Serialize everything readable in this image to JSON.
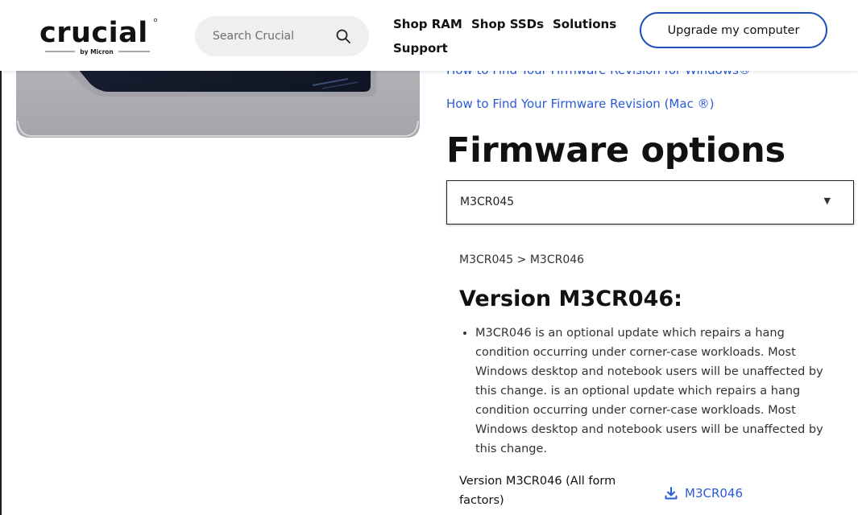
{
  "header": {
    "logo_text": "crucial",
    "logo_subtext": "by Micron",
    "search_placeholder": "Search Crucial",
    "nav": {
      "shop_ram": "Shop RAM",
      "shop_ssds": "Shop SSDs",
      "solutions": "Solutions",
      "support": "Support"
    },
    "upgrade_button": "Upgrade my computer"
  },
  "links": {
    "windows_partial": "How to Find Your Firmware Revision for Windows®",
    "mac": "How to Find Your Firmware Revision (Mac ®)"
  },
  "firmware": {
    "title": "Firmware options",
    "selected": "M3CR045",
    "breadcrumb": "M3CR045 > M3CR046",
    "version_heading": "Version M3CR046:",
    "notes": [
      "M3CR046 is an optional update which repairs a hang condition occurring under corner-case workloads. Most Windows desktop and notebook users will be unaffected by this change. is an optional update which repairs a hang condition occurring under corner-case workloads. Most Windows desktop and notebook users will be unaffected by this change."
    ],
    "download_label": "Version M3CR046 (All form factors)",
    "download_link": "M3CR046"
  },
  "colors": {
    "link": "#2a5bd7",
    "button_border": "#1f4fb8",
    "search_bg": "#efefef"
  },
  "icons": {
    "search": "search-icon",
    "dropdown": "caret-down-icon",
    "download": "download-icon"
  }
}
